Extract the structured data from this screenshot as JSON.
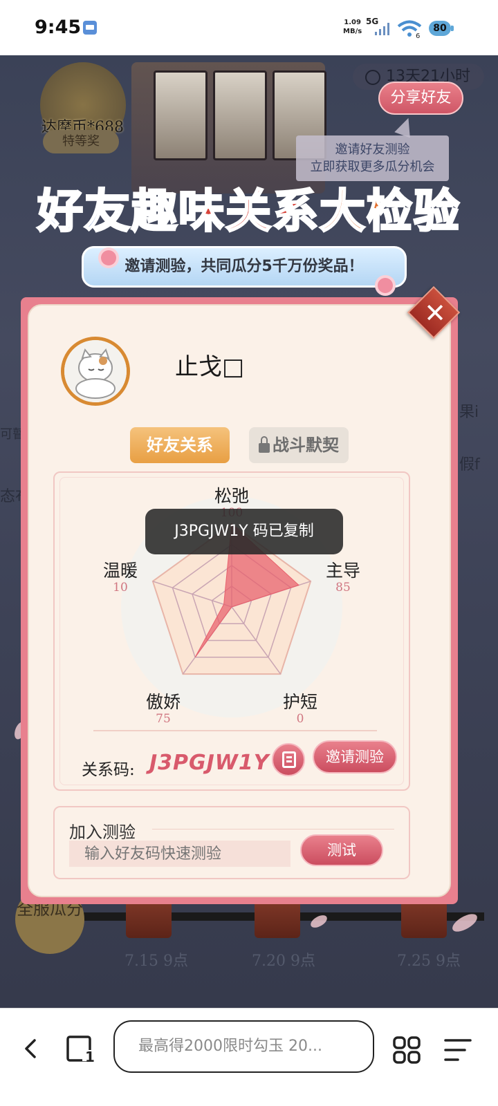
{
  "status_bar": {
    "time": "9:45",
    "net_speed_value": "1.09",
    "net_speed_unit": "MB/s",
    "network_type": "5G",
    "battery_level": "80",
    "wifi_subscript": "6"
  },
  "background": {
    "coin_reward": "达摩币*688",
    "prize_tier": "特等奖",
    "timer": "13天21小时",
    "share_button": "分享好友",
    "tooltip_line1": "邀请好友测验",
    "tooltip_line2": "立即获取更多瓜分机会",
    "title_part1": "好友",
    "title_part2": "趣味关系",
    "title_part3": "大检验",
    "subtitle": "邀请测验，共同瓜分5千万份奖品！",
    "all_server": "全服瓜分",
    "dates": [
      "7.15 9点",
      "7.20 9点",
      "7.25 9点"
    ],
    "side_right1": "果i",
    "side_right2": "假f",
    "side_left1": "可瞽",
    "side_left2": "态布"
  },
  "modal": {
    "username": "止戈□",
    "tabs": [
      {
        "label": "好友关系",
        "active": true
      },
      {
        "label": "战斗默契",
        "locked": true
      }
    ],
    "radar": {
      "max": 100,
      "axes": [
        {
          "label": "松弛",
          "value": "100"
        },
        {
          "label": "主导",
          "value": "85"
        },
        {
          "label": "护短",
          "value": "0"
        },
        {
          "label": "傲娇",
          "value": "75"
        },
        {
          "label": "温暖",
          "value": "10"
        }
      ],
      "fill_color": "#e8606c"
    },
    "code_label": "关系码:",
    "code_value": "J3PGJW1Y",
    "invite_button": "邀请测验",
    "join_title": "加入测验",
    "join_placeholder": "输入好友码快速测验",
    "test_button": "测试",
    "toast": "J3PGJW1Y 码已复制"
  },
  "browser_bar": {
    "search_text": "最高得2000限时勾玉 20..."
  },
  "colors": {
    "accent_pink": "#d85a6c",
    "tab_orange": "#e89f43",
    "modal_border": "#e8808e"
  }
}
